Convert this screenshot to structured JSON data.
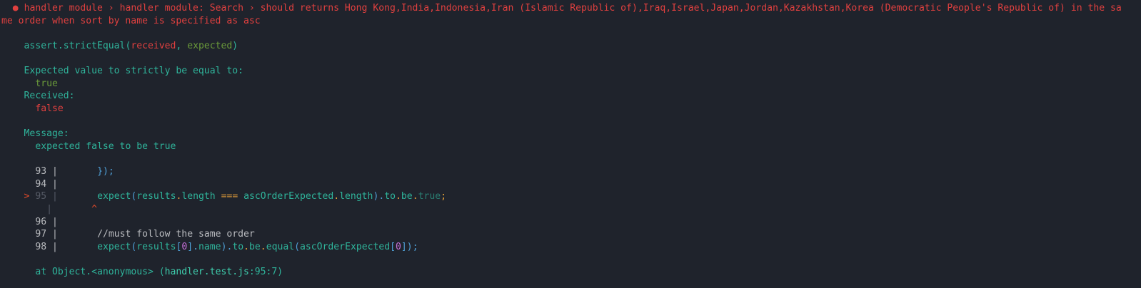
{
  "error": {
    "bullet": "●",
    "title_line1": "handler module › handler module: Search › should returns Hong Kong,India,Indonesia,Iran (Islamic Republic of),Iraq,Israel,Japan,Jordan,Kazakhstan,Korea (Democratic People's Republic of) in the sa",
    "title_line2": "me order when sort by name is specified as asc"
  },
  "assert": {
    "prefix": "assert.strictEqual(",
    "received_arg": "received",
    "comma": ", ",
    "expected_arg": "expected",
    "suffix": ")"
  },
  "comparison": {
    "expected_label": "Expected value to strictly be equal to:",
    "expected_value": "true",
    "received_label": "Received:",
    "received_value": "false"
  },
  "message": {
    "label": "Message:",
    "text": "expected false to be true"
  },
  "code_frame": {
    "gutter_sep": "|",
    "pointer": ">",
    "lines": [
      {
        "num": "93",
        "segments": [
          "});"
        ]
      },
      {
        "num": "94",
        "segments": []
      },
      {
        "num": "95",
        "segments": [
          "expect",
          "(",
          "results",
          ".",
          "length",
          " ",
          "===",
          " ",
          "ascOrderExpected",
          ".",
          "length",
          ").",
          "to",
          ".",
          "be",
          ".",
          "true",
          ";"
        ]
      },
      {
        "num": "",
        "segments": [
          "^"
        ]
      },
      {
        "num": "96",
        "segments": []
      },
      {
        "num": "97",
        "segments": [
          "//must follow the same order"
        ]
      },
      {
        "num": "98",
        "segments": [
          "expect",
          "(",
          "results",
          "[",
          "0",
          "].",
          "name",
          ").",
          "to",
          ".",
          "be",
          ".",
          "equal",
          "(",
          "ascOrderExpected",
          "[",
          "0",
          "]);"
        ]
      }
    ]
  },
  "stack": {
    "at_text": "at Object.<anonymous> (",
    "file": "handler.test.js",
    "loc": ":95:7",
    "close": ")"
  }
}
